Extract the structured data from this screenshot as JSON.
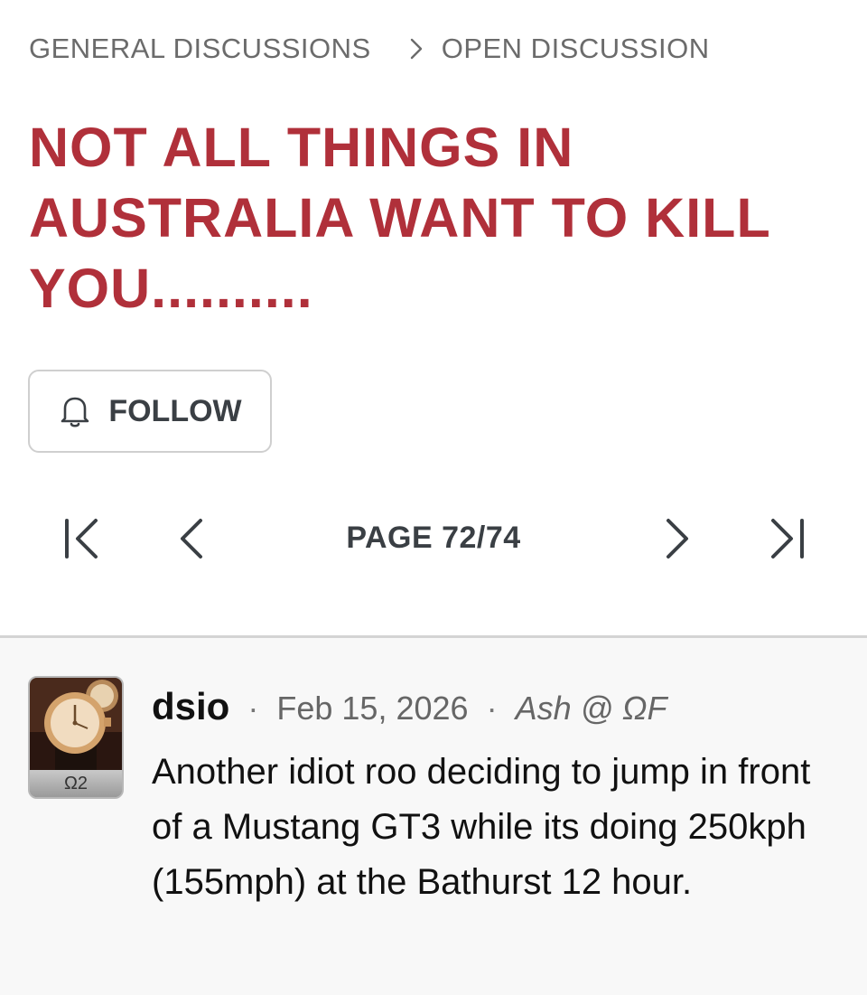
{
  "breadcrumb": {
    "parent": "GENERAL DISCUSSIONS",
    "current": "OPEN DISCUSSION"
  },
  "thread": {
    "title": "NOT ALL THINGS IN AUSTRALIA WANT TO KILL YOU.........."
  },
  "follow": {
    "label": "FOLLOW",
    "icon": "bell-icon"
  },
  "pagination": {
    "label": "PAGE 72/74",
    "current": 72,
    "total": 74,
    "icons": [
      "first-page-icon",
      "prev-page-icon",
      "next-page-icon",
      "last-page-icon"
    ]
  },
  "post": {
    "username": "dsio",
    "date": "Feb 15, 2026",
    "location": "Ash @ ΩF",
    "avatar_badge": "Ω2",
    "text": "Another idiot roo deciding to jump in front of a Mustang GT3 while its doing 250kph (155mph) at the Bathurst 12 hour."
  },
  "colors": {
    "title": "#b0303a",
    "breadcrumb": "#6b6b6b",
    "button_text": "#3a3f44",
    "divider": "#d4d4d4",
    "post_background": "#f8f8f8"
  }
}
